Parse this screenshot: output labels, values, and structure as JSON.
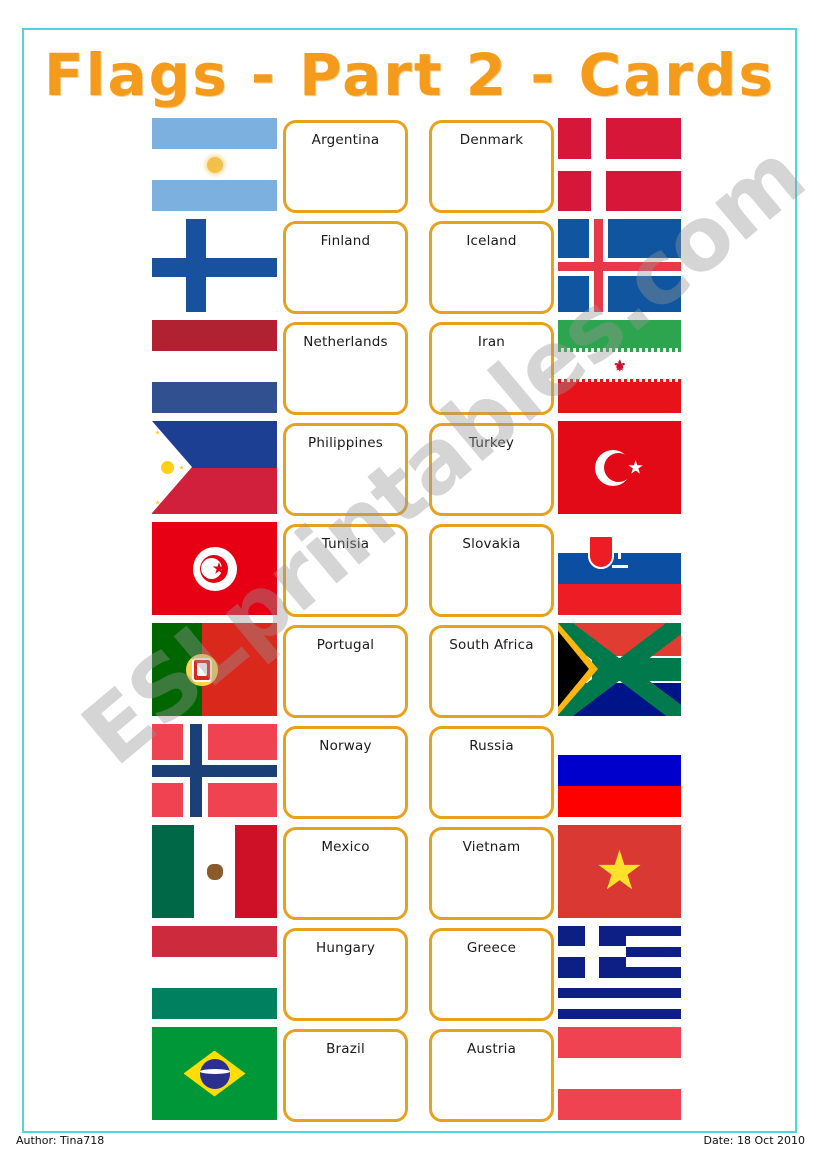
{
  "worksheet": {
    "title": "Flags - Part 2 - Cards",
    "watermark": "ESLprintables.com",
    "footer": {
      "author": "Author: Tina718",
      "date": "Date: 18 Oct 2010"
    },
    "colors": {
      "title": "#F59B1C",
      "card_border": "#E8A11B",
      "page_border": "#4DD5E0",
      "watermark": "#969696"
    }
  },
  "rows": [
    {
      "left_flag": "argentina-flag",
      "card_1": "Argentina",
      "card_2": "Denmark",
      "right_flag": "denmark-flag"
    },
    {
      "left_flag": "finland-flag",
      "card_1": "Finland",
      "card_2": "Iceland",
      "right_flag": "iceland-flag"
    },
    {
      "left_flag": "netherlands-flag",
      "card_1": "Netherlands",
      "card_2": "Iran",
      "right_flag": "iran-flag"
    },
    {
      "left_flag": "philippines-flag",
      "card_1": "Philippines",
      "card_2": "Turkey",
      "right_flag": "turkey-flag"
    },
    {
      "left_flag": "tunisia-flag",
      "card_1": "Tunisia",
      "card_2": "Slovakia",
      "right_flag": "slovakia-flag"
    },
    {
      "left_flag": "portugal-flag",
      "card_1": "Portugal",
      "card_2": "South Africa",
      "right_flag": "southafrica-flag"
    },
    {
      "left_flag": "norway-flag",
      "card_1": "Norway",
      "card_2": "Russia",
      "right_flag": "russia-flag"
    },
    {
      "left_flag": "mexico-flag",
      "card_1": "Mexico",
      "card_2": "Vietnam",
      "right_flag": "vietnam-flag"
    },
    {
      "left_flag": "hungary-flag",
      "card_1": "Hungary",
      "card_2": "Greece",
      "right_flag": "greece-flag"
    },
    {
      "left_flag": "brazil-flag",
      "card_1": "Brazil",
      "card_2": "Austria",
      "right_flag": "austria-flag"
    }
  ]
}
